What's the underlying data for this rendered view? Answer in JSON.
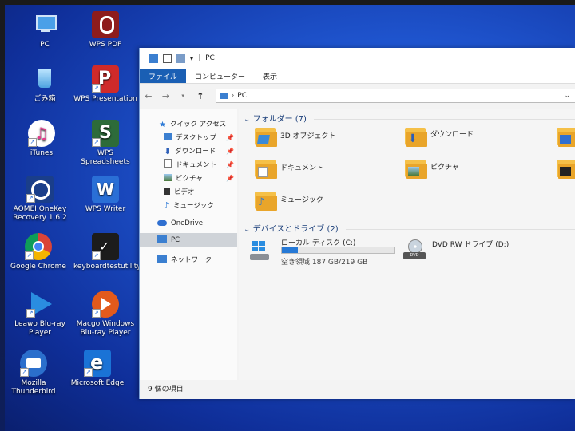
{
  "desktop": {
    "icons": [
      {
        "label": "PC",
        "icon": "pc-icon"
      },
      {
        "label": "WPS PDF",
        "icon": "wps-pdf-icon"
      },
      {
        "label": "ごみ箱",
        "icon": "recycle-bin-icon"
      },
      {
        "label": "WPS Presentation",
        "icon": "wps-presentation-icon"
      },
      {
        "label": "iTunes",
        "icon": "itunes-icon"
      },
      {
        "label": "WPS Spreadsheets",
        "icon": "wps-spreadsheets-icon"
      },
      {
        "label": "AOMEI OneKey Recovery 1.6.2",
        "icon": "aomei-icon"
      },
      {
        "label": "WPS Writer",
        "icon": "wps-writer-icon"
      },
      {
        "label": "Google Chrome",
        "icon": "chrome-icon"
      },
      {
        "label": "keyboardtestutility",
        "icon": "keyboard-test-icon"
      },
      {
        "label": "Leawo Blu-ray Player",
        "icon": "leawo-icon"
      },
      {
        "label": "Macgo Windows Blu-ray Player",
        "icon": "macgo-icon"
      },
      {
        "label": "Mozilla Thunderbird",
        "icon": "thunderbird-icon"
      },
      {
        "label": "Microsoft Edge",
        "icon": "edge-icon"
      }
    ]
  },
  "window": {
    "title": "PC",
    "ribbon_tabs": [
      "ファイル",
      "コンピューター",
      "表示"
    ],
    "address": "PC",
    "nav_items": [
      {
        "label": "クイック アクセス",
        "icon": "star-icon"
      },
      {
        "label": "デスクトップ",
        "icon": "desktop-folder-icon",
        "pinned": true
      },
      {
        "label": "ダウンロード",
        "icon": "download-arrow-icon",
        "pinned": true
      },
      {
        "label": "ドキュメント",
        "icon": "document-icon",
        "pinned": true
      },
      {
        "label": "ピクチャ",
        "icon": "picture-icon",
        "pinned": true
      },
      {
        "label": "ビデオ",
        "icon": "video-icon"
      },
      {
        "label": "ミュージック",
        "icon": "music-icon"
      },
      {
        "label": "OneDrive",
        "icon": "cloud-icon"
      },
      {
        "label": "PC",
        "icon": "pc-icon",
        "selected": true
      },
      {
        "label": "ネットワーク",
        "icon": "network-icon"
      }
    ],
    "folders_header": "フォルダー (7)",
    "folders": [
      {
        "label": "3D オブジェクト",
        "icon": "3d-objects-folder-icon"
      },
      {
        "label": "ダウンロード",
        "icon": "downloads-folder-icon"
      },
      {
        "label": "ドキュメント",
        "icon": "documents-folder-icon"
      },
      {
        "label": "ピクチャ",
        "icon": "pictures-folder-icon"
      },
      {
        "label": "ミュージック",
        "icon": "music-folder-icon"
      }
    ],
    "devices_header": "デバイスとドライブ (2)",
    "drives": [
      {
        "label": "ローカル ディスク (C:)",
        "free": "空き領域 187 GB/219 GB",
        "used_fraction": 0.146,
        "icon": "hard-disk-icon"
      },
      {
        "label": "DVD RW ドライブ (D:)",
        "icon": "dvd-drive-icon"
      }
    ],
    "status": "9 個の項目"
  },
  "colors": {
    "accent": "#1a5fb4",
    "bar": "#2679d6",
    "folder": "#f5c048"
  }
}
